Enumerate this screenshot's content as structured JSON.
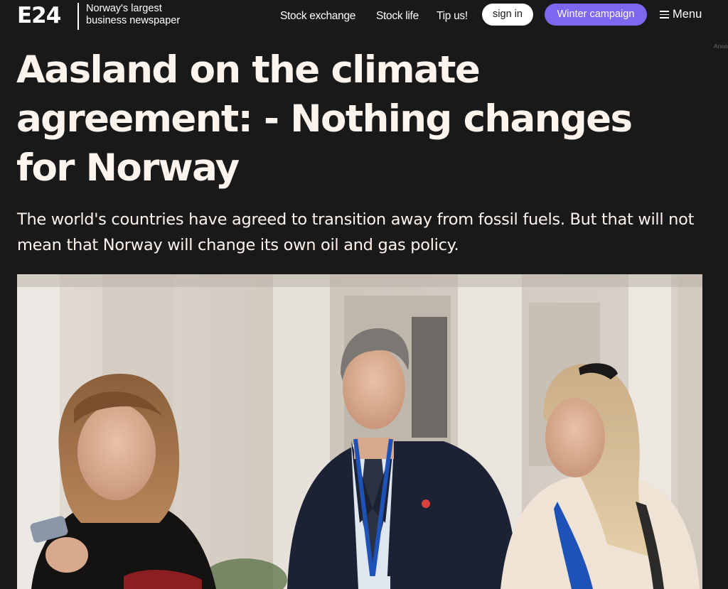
{
  "header": {
    "logo_text": "E24",
    "tagline_line1": "Norway's largest",
    "tagline_line2": "business newspaper",
    "nav": [
      {
        "label": "Stock exchange"
      },
      {
        "label": "Stock life"
      },
      {
        "label": "Tip us!"
      }
    ],
    "signin_label": "sign in",
    "winter_label": "Winter campaign",
    "menu_label": "Menu",
    "menu_icon": "hamburger-icon"
  },
  "ad_label": "Anno",
  "article": {
    "headline": "Aasland on the climate agreement: - Nothing changes for Norway",
    "subheadline": "The world's countries have agreed to transition away from fossil fuels. But that will not mean that Norway will change its own oil and gas policy."
  },
  "colors": {
    "background": "#1a191a",
    "headline_text": "#fdf4ee",
    "accent_purple": "#7b68ee",
    "button_white": "#ffffff"
  }
}
